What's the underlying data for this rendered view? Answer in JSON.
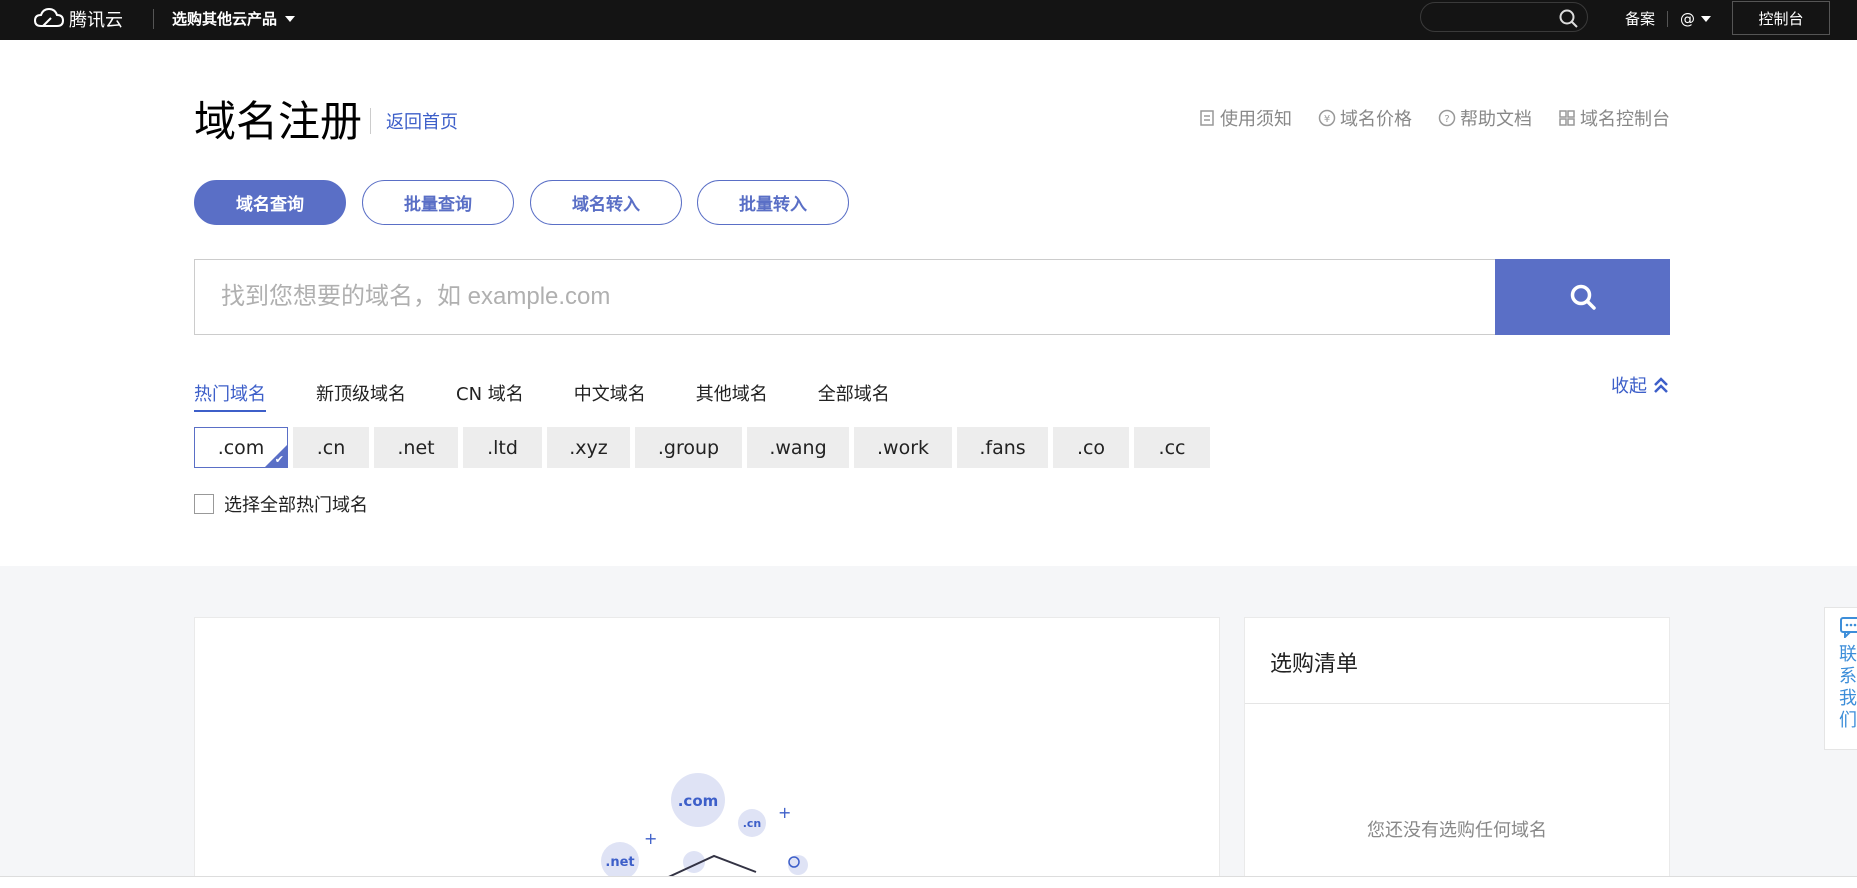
{
  "topbar": {
    "logo_text": "腾讯云",
    "products_label": "选购其他云产品",
    "search_placeholder": "",
    "beian_label": "备案",
    "account_label": "@",
    "console_label": "控制台"
  },
  "header": {
    "title": "域名注册",
    "back_home": "返回首页",
    "links": [
      {
        "label": "使用须知",
        "icon": "document-icon"
      },
      {
        "label": "域名价格",
        "icon": "yen-icon"
      },
      {
        "label": "帮助文档",
        "icon": "help-icon"
      },
      {
        "label": "域名控制台",
        "icon": "grid-icon"
      }
    ]
  },
  "tabs": [
    {
      "label": "域名查询",
      "active": true
    },
    {
      "label": "批量查询",
      "active": false
    },
    {
      "label": "域名转入",
      "active": false
    },
    {
      "label": "批量转入",
      "active": false
    }
  ],
  "search": {
    "placeholder": "找到您想要的域名，如 example.com",
    "value": ""
  },
  "categories": [
    {
      "label": "热门域名",
      "active": true
    },
    {
      "label": "新顶级域名",
      "active": false
    },
    {
      "label": "CN 域名",
      "active": false
    },
    {
      "label": "中文域名",
      "active": false
    },
    {
      "label": "其他域名",
      "active": false
    },
    {
      "label": "全部域名",
      "active": false
    }
  ],
  "collapse_label": "收起",
  "suffixes": [
    {
      "label": ".com",
      "selected": true
    },
    {
      "label": ".cn",
      "selected": false
    },
    {
      "label": ".net",
      "selected": false
    },
    {
      "label": ".ltd",
      "selected": false
    },
    {
      "label": ".xyz",
      "selected": false
    },
    {
      "label": ".group",
      "selected": false
    },
    {
      "label": ".wang",
      "selected": false
    },
    {
      "label": ".work",
      "selected": false
    },
    {
      "label": ".fans",
      "selected": false
    },
    {
      "label": ".co",
      "selected": false
    },
    {
      "label": ".cc",
      "selected": false
    }
  ],
  "select_all_label": "选择全部热门域名",
  "illustration": {
    "bubble_com": ".com",
    "bubble_cn": ".cn",
    "bubble_net": ".net"
  },
  "cart": {
    "title": "选购清单",
    "empty_text": "您还没有选购任何域名"
  },
  "contact": {
    "label_chars": [
      "联",
      "系",
      "我",
      "们"
    ]
  },
  "colors": {
    "accent": "#5a6fc6",
    "link": "#3d5fc9",
    "topbar": "#141414"
  }
}
